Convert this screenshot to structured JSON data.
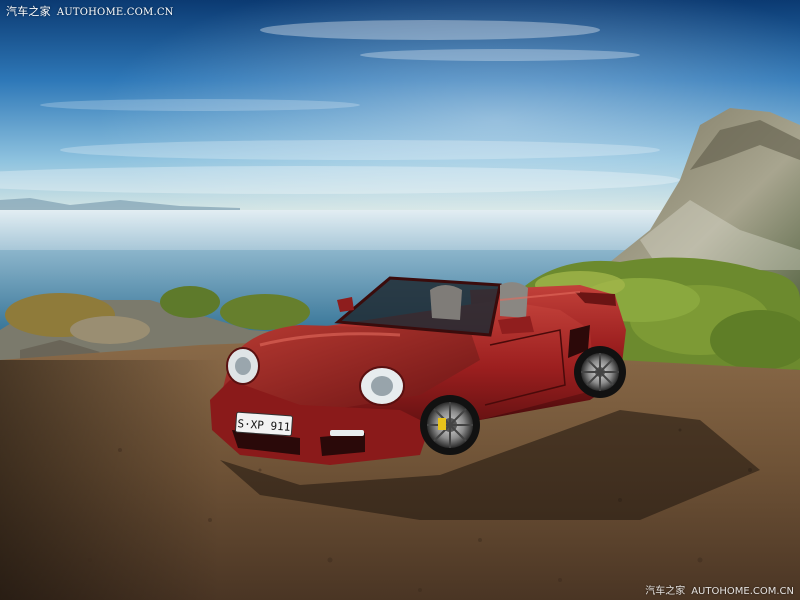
{
  "watermark_top": {
    "brand_cn": "汽车之家",
    "url": "AUTOHOME.COM.CN"
  },
  "watermark_bottom": {
    "brand_cn": "汽车之家",
    "url": "AUTOHOME.COM.CN"
  },
  "license_plate": "S·XP 911",
  "colors": {
    "sky_top": "#0d3f78",
    "sky_mid": "#3c86c4",
    "horizon": "#e8efe9",
    "sea": "#4c7fa0",
    "car_body": "#8e1f1f",
    "ground": "#6b5136"
  }
}
